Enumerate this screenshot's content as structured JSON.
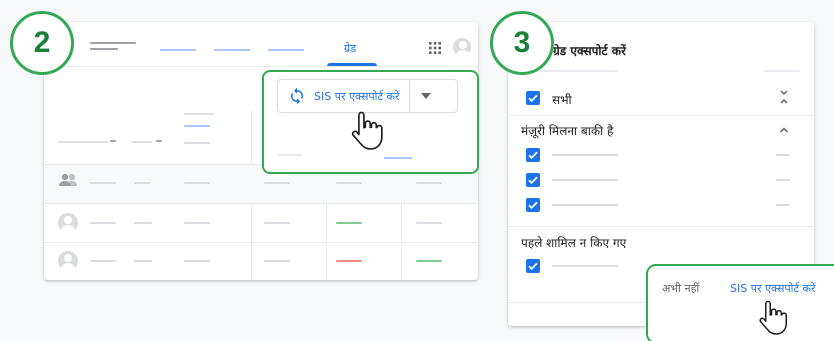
{
  "steps": {
    "left": "2",
    "right": "3"
  },
  "gradebook": {
    "tab_label": "ग्रेड",
    "export_button_label": "SIS पर एक्सपोर्ट करें"
  },
  "dialog": {
    "title": "ग्रेड एक्सपोर्ट करें",
    "all_label": "सभी",
    "pending_section_label": "मंज़ूरी मिलना बाकी है",
    "not_included_section_label": "पहले शामिल न किए गए",
    "not_now_button": "अभी नहीं",
    "export_button": "SIS पर एक्सपोर्ट करें"
  },
  "colors": {
    "accent": "#1a73e8",
    "highlight": "#34a853"
  },
  "icons": [
    "menu-icon",
    "apps-grid-icon",
    "avatar-icon",
    "sync-icon",
    "dropdown-arrow-icon",
    "hand-cursor-icon",
    "people-icon",
    "check-icon",
    "collapse-all-icon",
    "chevron-up-icon"
  ]
}
